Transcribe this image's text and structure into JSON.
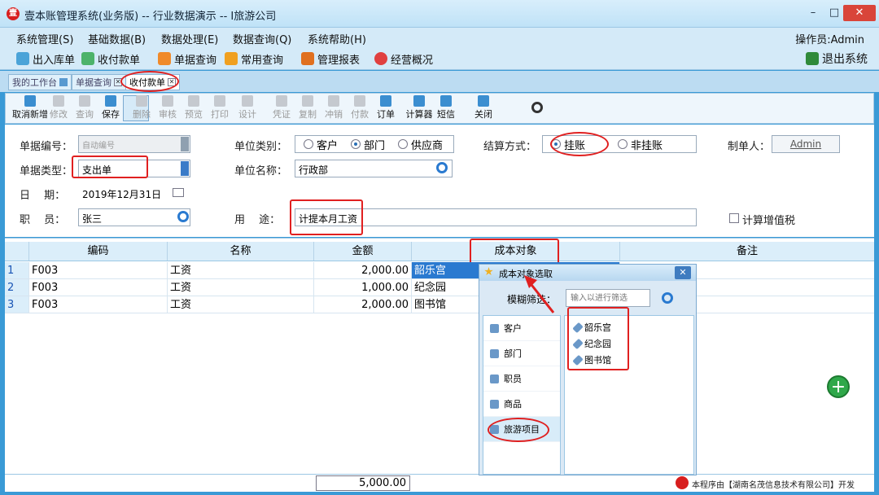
{
  "window": {
    "title": "壹本账管理系统(业务版) -- 行业数据演示 -- I旅游公司",
    "logo": "壹"
  },
  "menu": [
    "系统管理(S)",
    "基础数据(B)",
    "数据处理(E)",
    "数据查询(Q)",
    "系统帮助(H)"
  ],
  "operator": "操作员:Admin",
  "quickbar": [
    "出入库单",
    "收付款单",
    "单据查询",
    "常用查询",
    "管理报表",
    "经营概况"
  ],
  "exit_label": "退出系统",
  "tabs": [
    "我的工作台",
    "单据查询",
    "收付款单"
  ],
  "toolbar": [
    {
      "label": "取消新增",
      "on": true
    },
    {
      "label": "修改",
      "on": false
    },
    {
      "label": "查询",
      "on": false
    },
    {
      "label": "保存",
      "on": true
    },
    {
      "label": "删除",
      "on": false
    },
    {
      "label": "审核",
      "on": false
    },
    {
      "label": "预览",
      "on": false
    },
    {
      "label": "打印",
      "on": false
    },
    {
      "label": "设计",
      "on": false
    },
    {
      "label": "凭证",
      "on": false
    },
    {
      "label": "复制",
      "on": false
    },
    {
      "label": "冲销",
      "on": false
    },
    {
      "label": "付款",
      "on": false
    },
    {
      "label": "订单",
      "on": true
    },
    {
      "label": "计算器",
      "on": true
    },
    {
      "label": "短信",
      "on": true
    },
    {
      "label": "关闭",
      "on": true
    }
  ],
  "form": {
    "doc_no_label": "单据编号：",
    "doc_no_placeholder": "自动编号",
    "doc_type_label": "单据类型：",
    "doc_type_value": "支出单",
    "date_label": "日　 期：",
    "date_value": "2019年12月31日",
    "staff_label": "职　 员：",
    "staff_value": "张三",
    "unit_type_label": "单位类别：",
    "unit_types": [
      "客户",
      "部门",
      "供应商"
    ],
    "unit_type_selected": "部门",
    "unit_name_label": "单位名称：",
    "unit_name_value": "行政部",
    "purpose_label": "用　 途：",
    "purpose_value": "计提本月工资",
    "settle_label": "结算方式：",
    "settle_options": [
      "挂账",
      "非挂账"
    ],
    "settle_selected": "挂账",
    "maker_label": "制单人：",
    "maker_value": "Admin",
    "vat_label": "计算增值税"
  },
  "grid": {
    "columns": [
      "编码",
      "名称",
      "金额",
      "成本对象",
      "备注"
    ],
    "rows": [
      {
        "no": "1",
        "code": "F003",
        "name": "工资",
        "amount": "2,000.00",
        "cost": "韶乐宫"
      },
      {
        "no": "2",
        "code": "F003",
        "name": "工资",
        "amount": "1,000.00",
        "cost": "纪念园"
      },
      {
        "no": "3",
        "code": "F003",
        "name": "工资",
        "amount": "2,000.00",
        "cost": "图书馆"
      }
    ],
    "total": "5,000.00"
  },
  "popup": {
    "title": "成本对象选取",
    "filter_label": "模糊筛选：",
    "filter_placeholder": "输入以进行筛选",
    "categories": [
      "客户",
      "部门",
      "职员",
      "商品",
      "旅游项目"
    ],
    "selected_category": "旅游项目",
    "items": [
      "韶乐宫",
      "纪念园",
      "图书馆"
    ]
  },
  "watermark": "本程序由【湖南名茂信息技术有限公司】开发",
  "colors": {
    "accent": "#3a9ad6",
    "highlight": "#e02020"
  }
}
